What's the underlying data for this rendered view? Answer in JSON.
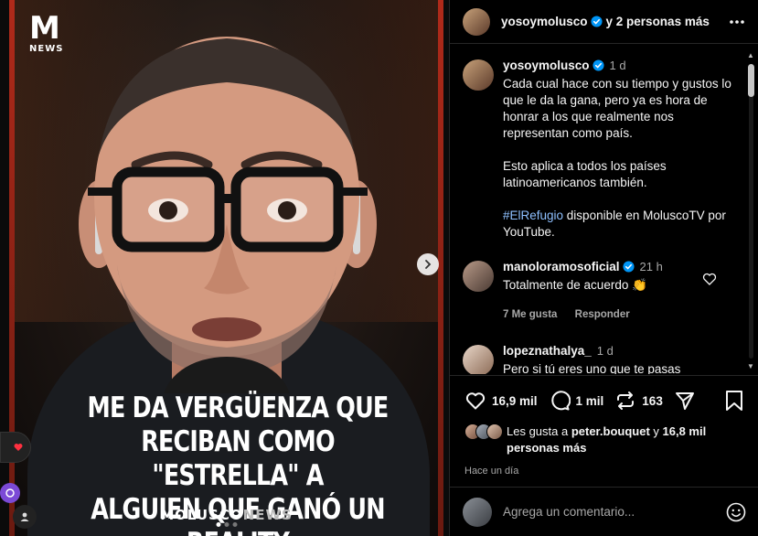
{
  "media": {
    "logo_letter": "M",
    "logo_sub": "NEWS",
    "headline_lines": [
      "Me da vergüenza que",
      "reciban como \"estrella\" a",
      "alguien que ganó un reality"
    ],
    "brand_bold": "MOLUSCO",
    "brand_light": "NEWS"
  },
  "header": {
    "username": "yosoymolusco",
    "suffix": "y 2 personas más"
  },
  "caption": {
    "username": "yosoymolusco",
    "time": "1 d",
    "para1": "Cada cual hace con su tiempo y gustos lo que le da la gana, pero ya es hora de honrar a los que realmente nos representan como país.",
    "para2": "Esto aplica a todos los países latinoamericanos también.",
    "hashtag": "#ElRefugio",
    "para3_rest": " disponible en MoluscoTV por YouTube."
  },
  "comments": [
    {
      "username": "manoloramosoficial",
      "time": "21 h",
      "text": "Totalmente de acuerdo 👏",
      "likes": "7 Me gusta",
      "reply": "Responder"
    },
    {
      "username": "lopeznathalya_",
      "time": "1 d",
      "text": "Pero si tú eres uno que te pasas"
    }
  ],
  "actions": {
    "likes_count": "16,9 mil",
    "comments_count": "1 mil",
    "reposts_count": "163"
  },
  "likes_summary": {
    "prefix": "Les gusta a ",
    "user": "peter.bouquet",
    "middle": " y ",
    "others": "16,8 mil personas más"
  },
  "posted": "Hace un día",
  "composer": {
    "placeholder": "Agrega un comentario..."
  },
  "colors": {
    "background": "#000000",
    "text": "#f5f5f5",
    "muted": "#a8a8a8",
    "verified": "#0095f6",
    "hashtag": "#8ec0ff"
  }
}
